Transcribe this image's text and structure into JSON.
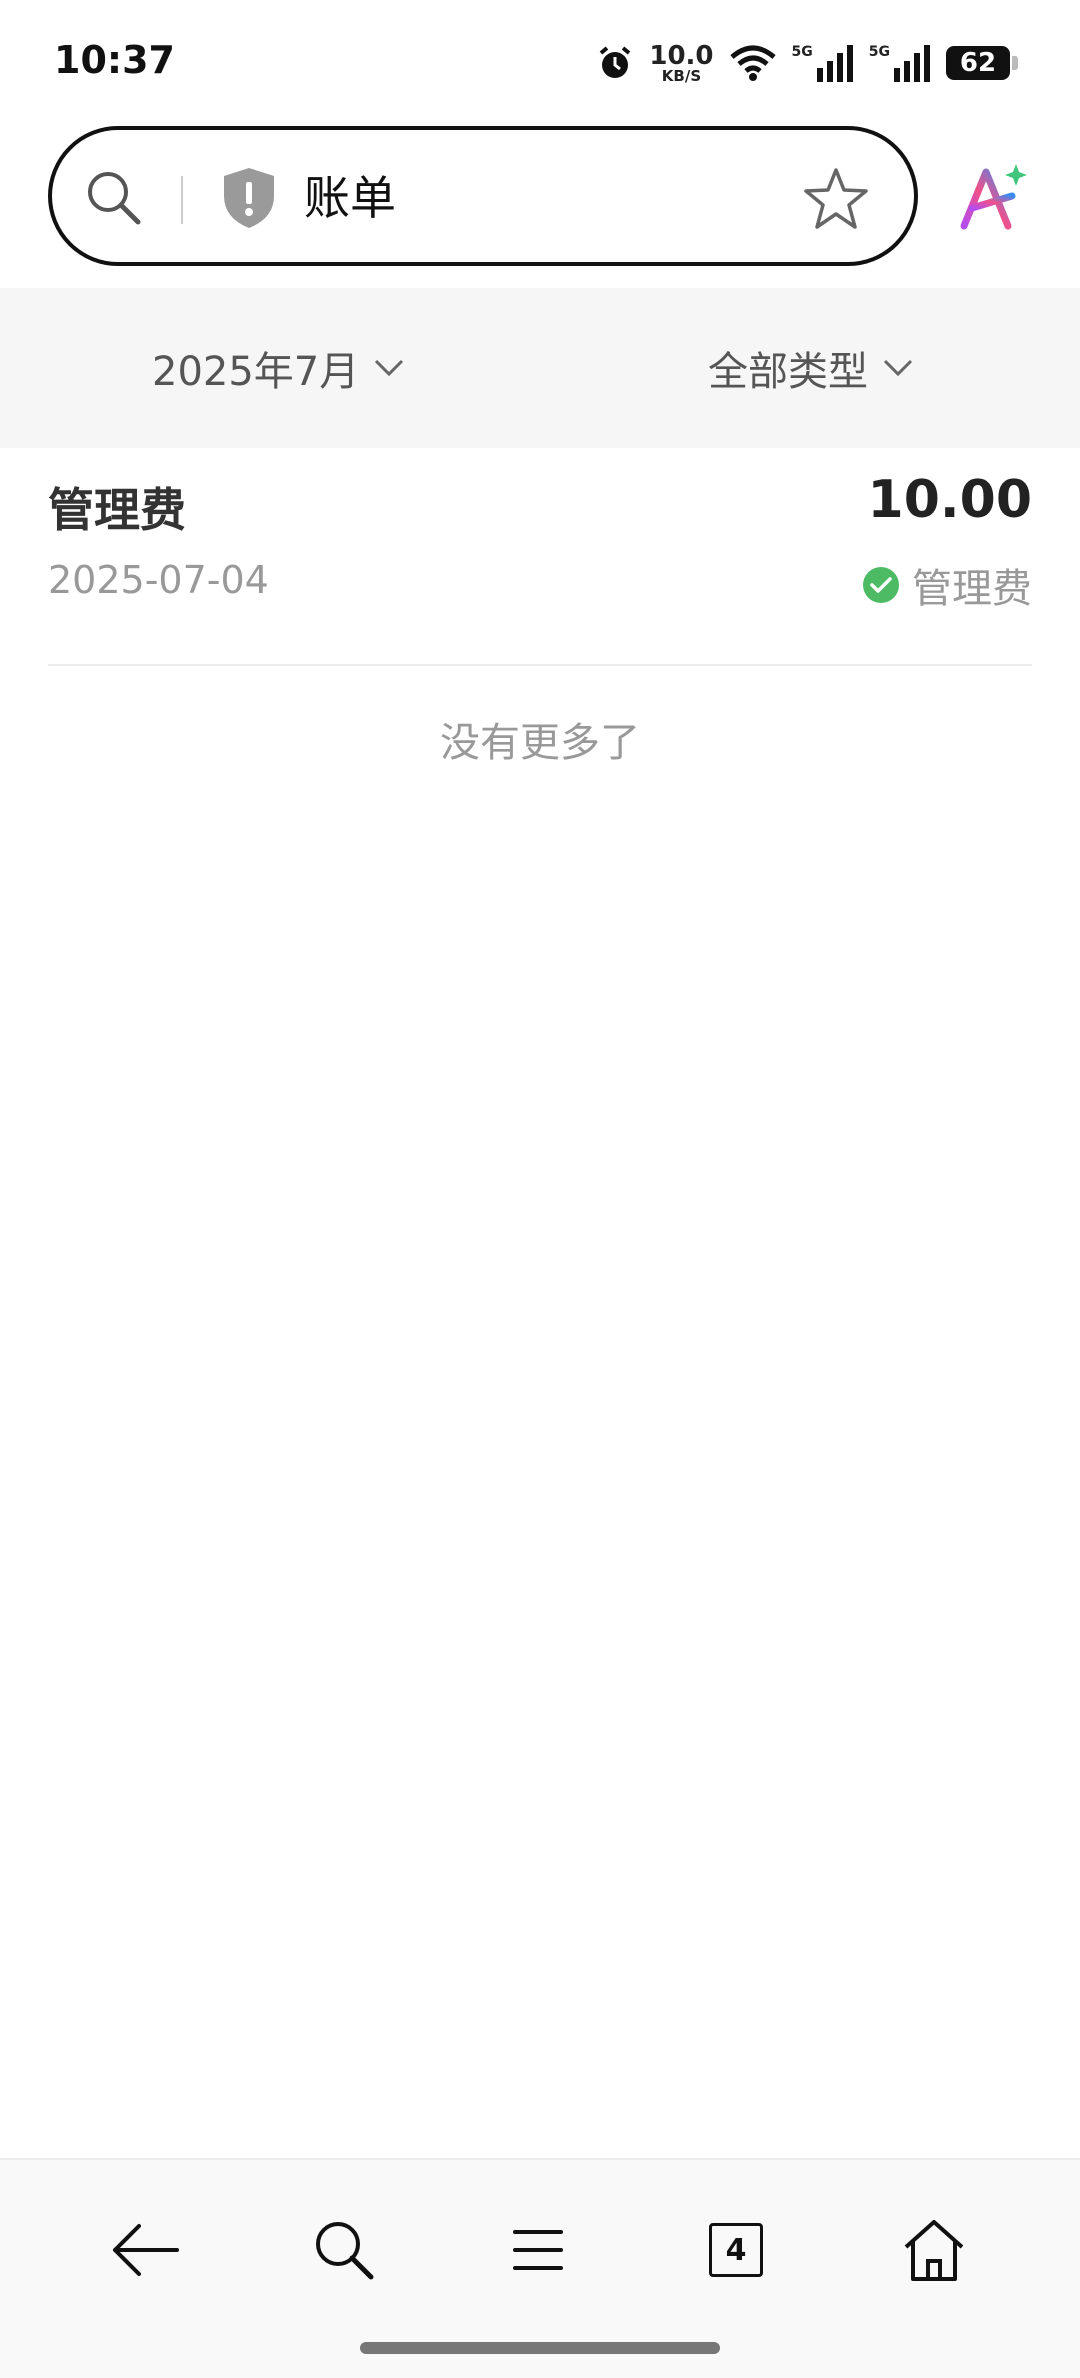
{
  "status_bar": {
    "time": "10:37",
    "net_speed_value": "10.0",
    "net_speed_unit": "KB/S",
    "signal1_label": "5G",
    "signal2_label": "5G",
    "battery": "62"
  },
  "search": {
    "query": "账单",
    "icons": [
      "search-icon",
      "shield-warning-icon",
      "star-icon",
      "ai-assistant-icon"
    ]
  },
  "filters": {
    "month": "2025年7月",
    "type": "全部类型"
  },
  "bills": [
    {
      "title": "管理费",
      "amount": "10.00",
      "date": "2025-07-04",
      "status": "管理费"
    }
  ],
  "list_end_text": "没有更多了",
  "bottom_nav": {
    "tab_count": "4",
    "icons": [
      "back-arrow-icon",
      "search-icon",
      "menu-icon",
      "tabs-icon",
      "home-icon"
    ]
  },
  "colors": {
    "accent_check": "#4cbb63",
    "text_muted": "#999999",
    "filter_bg": "#f6f6f6"
  }
}
